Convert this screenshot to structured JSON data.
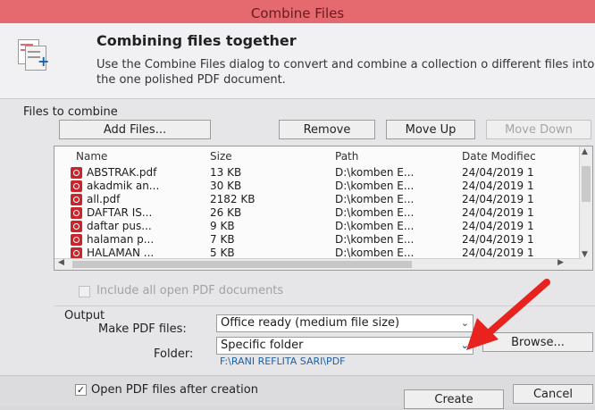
{
  "window": {
    "title": "Combine Files"
  },
  "header": {
    "title": "Combining files together",
    "description": "Use the Combine Files dialog to convert and combine a collection o different files into the one polished PDF document."
  },
  "files_section": {
    "label": "Files to combine",
    "buttons": {
      "add": "Add Files...",
      "remove": "Remove",
      "move_up": "Move Up",
      "move_down": "Move Down"
    },
    "columns": [
      "Name",
      "Size",
      "Path",
      "Date Modifiec"
    ],
    "rows": [
      {
        "name": "ABSTRAK.pdf",
        "size": "13 KB",
        "path": "D:\\komben E...",
        "date": "24/04/2019 1"
      },
      {
        "name": "akadmik an...",
        "size": "30 KB",
        "path": "D:\\komben E...",
        "date": "24/04/2019 1"
      },
      {
        "name": "all.pdf",
        "size": "2182 KB",
        "path": "D:\\komben E...",
        "date": "24/04/2019 1"
      },
      {
        "name": "DAFTAR IS...",
        "size": "26 KB",
        "path": "D:\\komben E...",
        "date": "24/04/2019 1"
      },
      {
        "name": "daftar pus...",
        "size": "9 KB",
        "path": "D:\\komben E...",
        "date": "24/04/2019 1"
      },
      {
        "name": "halaman p...",
        "size": "7 KB",
        "path": "D:\\komben E...",
        "date": "24/04/2019 1"
      },
      {
        "name": "HALAMAN ...",
        "size": "5 KB",
        "path": "D:\\komben E...",
        "date": "24/04/2019 1"
      }
    ],
    "include_open_label": "Include all open PDF documents"
  },
  "output": {
    "label": "Output",
    "make_pdf_label": "Make PDF files:",
    "make_pdf_value": "Office ready (medium file size)",
    "folder_label": "Folder:",
    "folder_value": "Specific folder",
    "browse_label": "Browse...",
    "folder_path": "F:\\RANI REFLITA SARI\\PDF"
  },
  "footer": {
    "open_after_label": "Open PDF files after creation",
    "open_after_checked": true,
    "create_label": "Create",
    "cancel_label": "Cancel"
  },
  "colors": {
    "titlebar": "#e46a70",
    "pdf_icon": "#c8262c",
    "link_blue": "#1f5fa7",
    "annotation_arrow": "#e8231f"
  }
}
